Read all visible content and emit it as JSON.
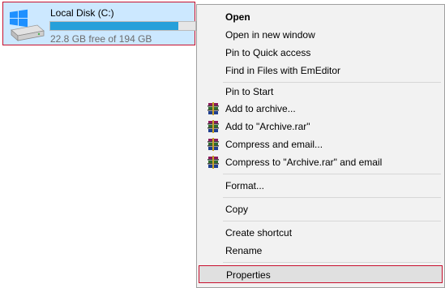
{
  "drive": {
    "name": "Local Disk (C:)",
    "free_text": "22.8 GB free of 194 GB",
    "used_fraction": 0.8825,
    "bar_color": "#26a0da",
    "icon": "hard-drive-windows-icon"
  },
  "menu": {
    "items": [
      {
        "label": "Open",
        "bold": true
      },
      {
        "label": "Open in new window"
      },
      {
        "label": "Pin to Quick access"
      },
      {
        "label": "Find in Files with EmEditor"
      },
      {
        "label": "Pin to Start"
      },
      {
        "label": "Add to archive...",
        "icon": "winrar-icon"
      },
      {
        "label": "Add to \"Archive.rar\"",
        "icon": "winrar-icon"
      },
      {
        "label": "Compress and email...",
        "icon": "winrar-icon"
      },
      {
        "label": "Compress to \"Archive.rar\" and email",
        "icon": "winrar-icon"
      },
      {
        "label": "Format..."
      },
      {
        "label": "Copy"
      },
      {
        "label": "Create shortcut"
      },
      {
        "label": "Rename"
      },
      {
        "label": "Properties",
        "highlighted": true
      }
    ]
  },
  "colors": {
    "highlight_border": "#c8102e",
    "selection_bg": "#cce8ff",
    "menu_bg": "#f2f2f2"
  }
}
